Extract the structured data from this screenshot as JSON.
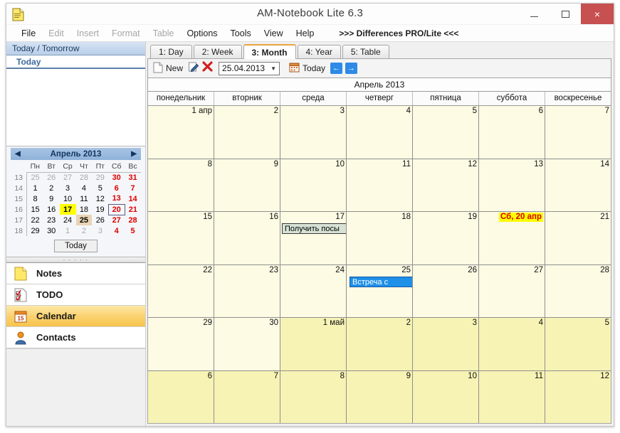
{
  "window": {
    "title": "AM-Notebook Lite  6.3",
    "app_icon": "document-icon",
    "minimize_label": "—",
    "maximize_label": "□",
    "close_label": "×"
  },
  "menubar": {
    "items": [
      {
        "label": "File",
        "disabled": false
      },
      {
        "label": "Edit",
        "disabled": true
      },
      {
        "label": "Insert",
        "disabled": true
      },
      {
        "label": "Format",
        "disabled": true
      },
      {
        "label": "Table",
        "disabled": true
      },
      {
        "label": "Options",
        "disabled": false
      },
      {
        "label": "Tools",
        "disabled": false
      },
      {
        "label": "View",
        "disabled": false
      },
      {
        "label": "Help",
        "disabled": false
      }
    ],
    "promo": ">>> Differences PRO/Lite <<<"
  },
  "sidebar": {
    "today_tomorrow_header": "Today / Tomorrow",
    "today_label": "Today",
    "minicalendar": {
      "prev_arrow": "◀",
      "next_arrow": "▶",
      "title": "Апрель 2013",
      "dow": [
        "Пн",
        "Вт",
        "Ср",
        "Чт",
        "Пт",
        "Сб",
        "Вс"
      ],
      "weeks": [
        {
          "num": "13",
          "days": [
            {
              "d": "25",
              "t": "other"
            },
            {
              "d": "26",
              "t": "other"
            },
            {
              "d": "27",
              "t": "other"
            },
            {
              "d": "28",
              "t": "other"
            },
            {
              "d": "29",
              "t": "other"
            },
            {
              "d": "30",
              "t": "wknd"
            },
            {
              "d": "31",
              "t": "wknd"
            }
          ]
        },
        {
          "num": "14",
          "days": [
            {
              "d": "1",
              "t": ""
            },
            {
              "d": "2",
              "t": ""
            },
            {
              "d": "3",
              "t": ""
            },
            {
              "d": "4",
              "t": ""
            },
            {
              "d": "5",
              "t": ""
            },
            {
              "d": "6",
              "t": "wknd"
            },
            {
              "d": "7",
              "t": "wknd"
            }
          ]
        },
        {
          "num": "15",
          "days": [
            {
              "d": "8",
              "t": ""
            },
            {
              "d": "9",
              "t": ""
            },
            {
              "d": "10",
              "t": ""
            },
            {
              "d": "11",
              "t": ""
            },
            {
              "d": "12",
              "t": ""
            },
            {
              "d": "13",
              "t": "wknd"
            },
            {
              "d": "14",
              "t": "wknd"
            }
          ]
        },
        {
          "num": "16",
          "days": [
            {
              "d": "15",
              "t": ""
            },
            {
              "d": "16",
              "t": ""
            },
            {
              "d": "17",
              "t": "today-hl"
            },
            {
              "d": "18",
              "t": ""
            },
            {
              "d": "19",
              "t": ""
            },
            {
              "d": "20",
              "t": "wknd sel-box"
            },
            {
              "d": "21",
              "t": "wknd"
            }
          ]
        },
        {
          "num": "17",
          "days": [
            {
              "d": "22",
              "t": ""
            },
            {
              "d": "23",
              "t": ""
            },
            {
              "d": "24",
              "t": ""
            },
            {
              "d": "25",
              "t": "tan"
            },
            {
              "d": "26",
              "t": ""
            },
            {
              "d": "27",
              "t": "wknd"
            },
            {
              "d": "28",
              "t": "wknd"
            }
          ]
        },
        {
          "num": "18",
          "days": [
            {
              "d": "29",
              "t": ""
            },
            {
              "d": "30",
              "t": ""
            },
            {
              "d": "1",
              "t": "other"
            },
            {
              "d": "2",
              "t": "other"
            },
            {
              "d": "3",
              "t": "other"
            },
            {
              "d": "4",
              "t": "wknd"
            },
            {
              "d": "5",
              "t": "wknd"
            }
          ]
        }
      ],
      "today_button": "Today"
    },
    "modules": [
      {
        "label": "Notes",
        "icon": "note-page-icon",
        "active": false
      },
      {
        "label": "TODO",
        "icon": "checklist-icon",
        "active": false
      },
      {
        "label": "Calendar",
        "icon": "calendar-page-icon",
        "active": true
      },
      {
        "label": "Contacts",
        "icon": "person-icon",
        "active": false
      }
    ]
  },
  "main": {
    "tabs": [
      {
        "label": "1: Day",
        "active": false
      },
      {
        "label": "2: Week",
        "active": false
      },
      {
        "label": "3: Month",
        "active": true
      },
      {
        "label": "4: Year",
        "active": false
      },
      {
        "label": "5: Table",
        "active": false
      }
    ],
    "toolbar": {
      "new_label": "New",
      "new_icon": "new-page-icon",
      "edit_icon": "edit-pencil-icon",
      "delete_icon": "delete-x-icon",
      "date_value": "25.04.2013",
      "date_caret": "▼",
      "today_label": "Today",
      "today_icon": "calendar-small-icon",
      "prev_arrow": "←",
      "next_arrow": "→"
    },
    "calendar": {
      "month_title": "Апрель 2013",
      "day_headers": [
        "понедельник",
        "вторник",
        "среда",
        "четверг",
        "пятница",
        "суббота",
        "воскресенье"
      ],
      "weeks": [
        [
          {
            "num": "1 апр",
            "outside": false,
            "events": []
          },
          {
            "num": "2",
            "outside": false,
            "events": []
          },
          {
            "num": "3",
            "outside": false,
            "events": []
          },
          {
            "num": "4",
            "outside": false,
            "events": []
          },
          {
            "num": "5",
            "outside": false,
            "events": []
          },
          {
            "num": "6",
            "outside": false,
            "events": []
          },
          {
            "num": "7",
            "outside": false,
            "events": []
          }
        ],
        [
          {
            "num": "8",
            "outside": false,
            "events": []
          },
          {
            "num": "9",
            "outside": false,
            "events": []
          },
          {
            "num": "10",
            "outside": false,
            "events": []
          },
          {
            "num": "11",
            "outside": false,
            "events": []
          },
          {
            "num": "12",
            "outside": false,
            "events": []
          },
          {
            "num": "13",
            "outside": false,
            "events": []
          },
          {
            "num": "14",
            "outside": false,
            "events": []
          }
        ],
        [
          {
            "num": "15",
            "outside": false,
            "events": []
          },
          {
            "num": "16",
            "outside": false,
            "events": []
          },
          {
            "num": "17",
            "outside": false,
            "events": [
              {
                "text": "Получить посы",
                "kind": "task"
              }
            ]
          },
          {
            "num": "18",
            "outside": false,
            "events": []
          },
          {
            "num": "19",
            "outside": false,
            "events": []
          },
          {
            "num": "Сб, 20 апр",
            "outside": false,
            "highlight": true,
            "events": []
          },
          {
            "num": "21",
            "outside": false,
            "events": []
          }
        ],
        [
          {
            "num": "22",
            "outside": false,
            "events": []
          },
          {
            "num": "23",
            "outside": false,
            "events": []
          },
          {
            "num": "24",
            "outside": false,
            "events": []
          },
          {
            "num": "25",
            "outside": false,
            "events": [
              {
                "text": "Встреча с",
                "kind": "meeting"
              }
            ]
          },
          {
            "num": "26",
            "outside": false,
            "events": []
          },
          {
            "num": "27",
            "outside": false,
            "events": []
          },
          {
            "num": "28",
            "outside": false,
            "events": []
          }
        ],
        [
          {
            "num": "29",
            "outside": false,
            "events": []
          },
          {
            "num": "30",
            "outside": false,
            "events": []
          },
          {
            "num": "1 май",
            "outside": true,
            "events": []
          },
          {
            "num": "2",
            "outside": true,
            "events": []
          },
          {
            "num": "3",
            "outside": true,
            "events": []
          },
          {
            "num": "4",
            "outside": true,
            "events": []
          },
          {
            "num": "5",
            "outside": true,
            "events": []
          }
        ],
        [
          {
            "num": "6",
            "outside": true,
            "events": []
          },
          {
            "num": "7",
            "outside": true,
            "events": []
          },
          {
            "num": "8",
            "outside": true,
            "events": []
          },
          {
            "num": "9",
            "outside": true,
            "events": []
          },
          {
            "num": "10",
            "outside": true,
            "events": []
          },
          {
            "num": "11",
            "outside": true,
            "events": []
          },
          {
            "num": "12",
            "outside": true,
            "events": []
          }
        ]
      ]
    }
  },
  "colors": {
    "close_button": "#c75050",
    "active_tab_accent": "#e8a33d",
    "day_cell": "#fdfbe4",
    "outside_day_cell": "#f7f3b4",
    "highlight_yellow": "#ffff00",
    "highlight_red_text": "#d40000",
    "meeting_blue": "#1e90e8",
    "task_green": "#d7e2d4",
    "module_active": "#fbd271"
  }
}
